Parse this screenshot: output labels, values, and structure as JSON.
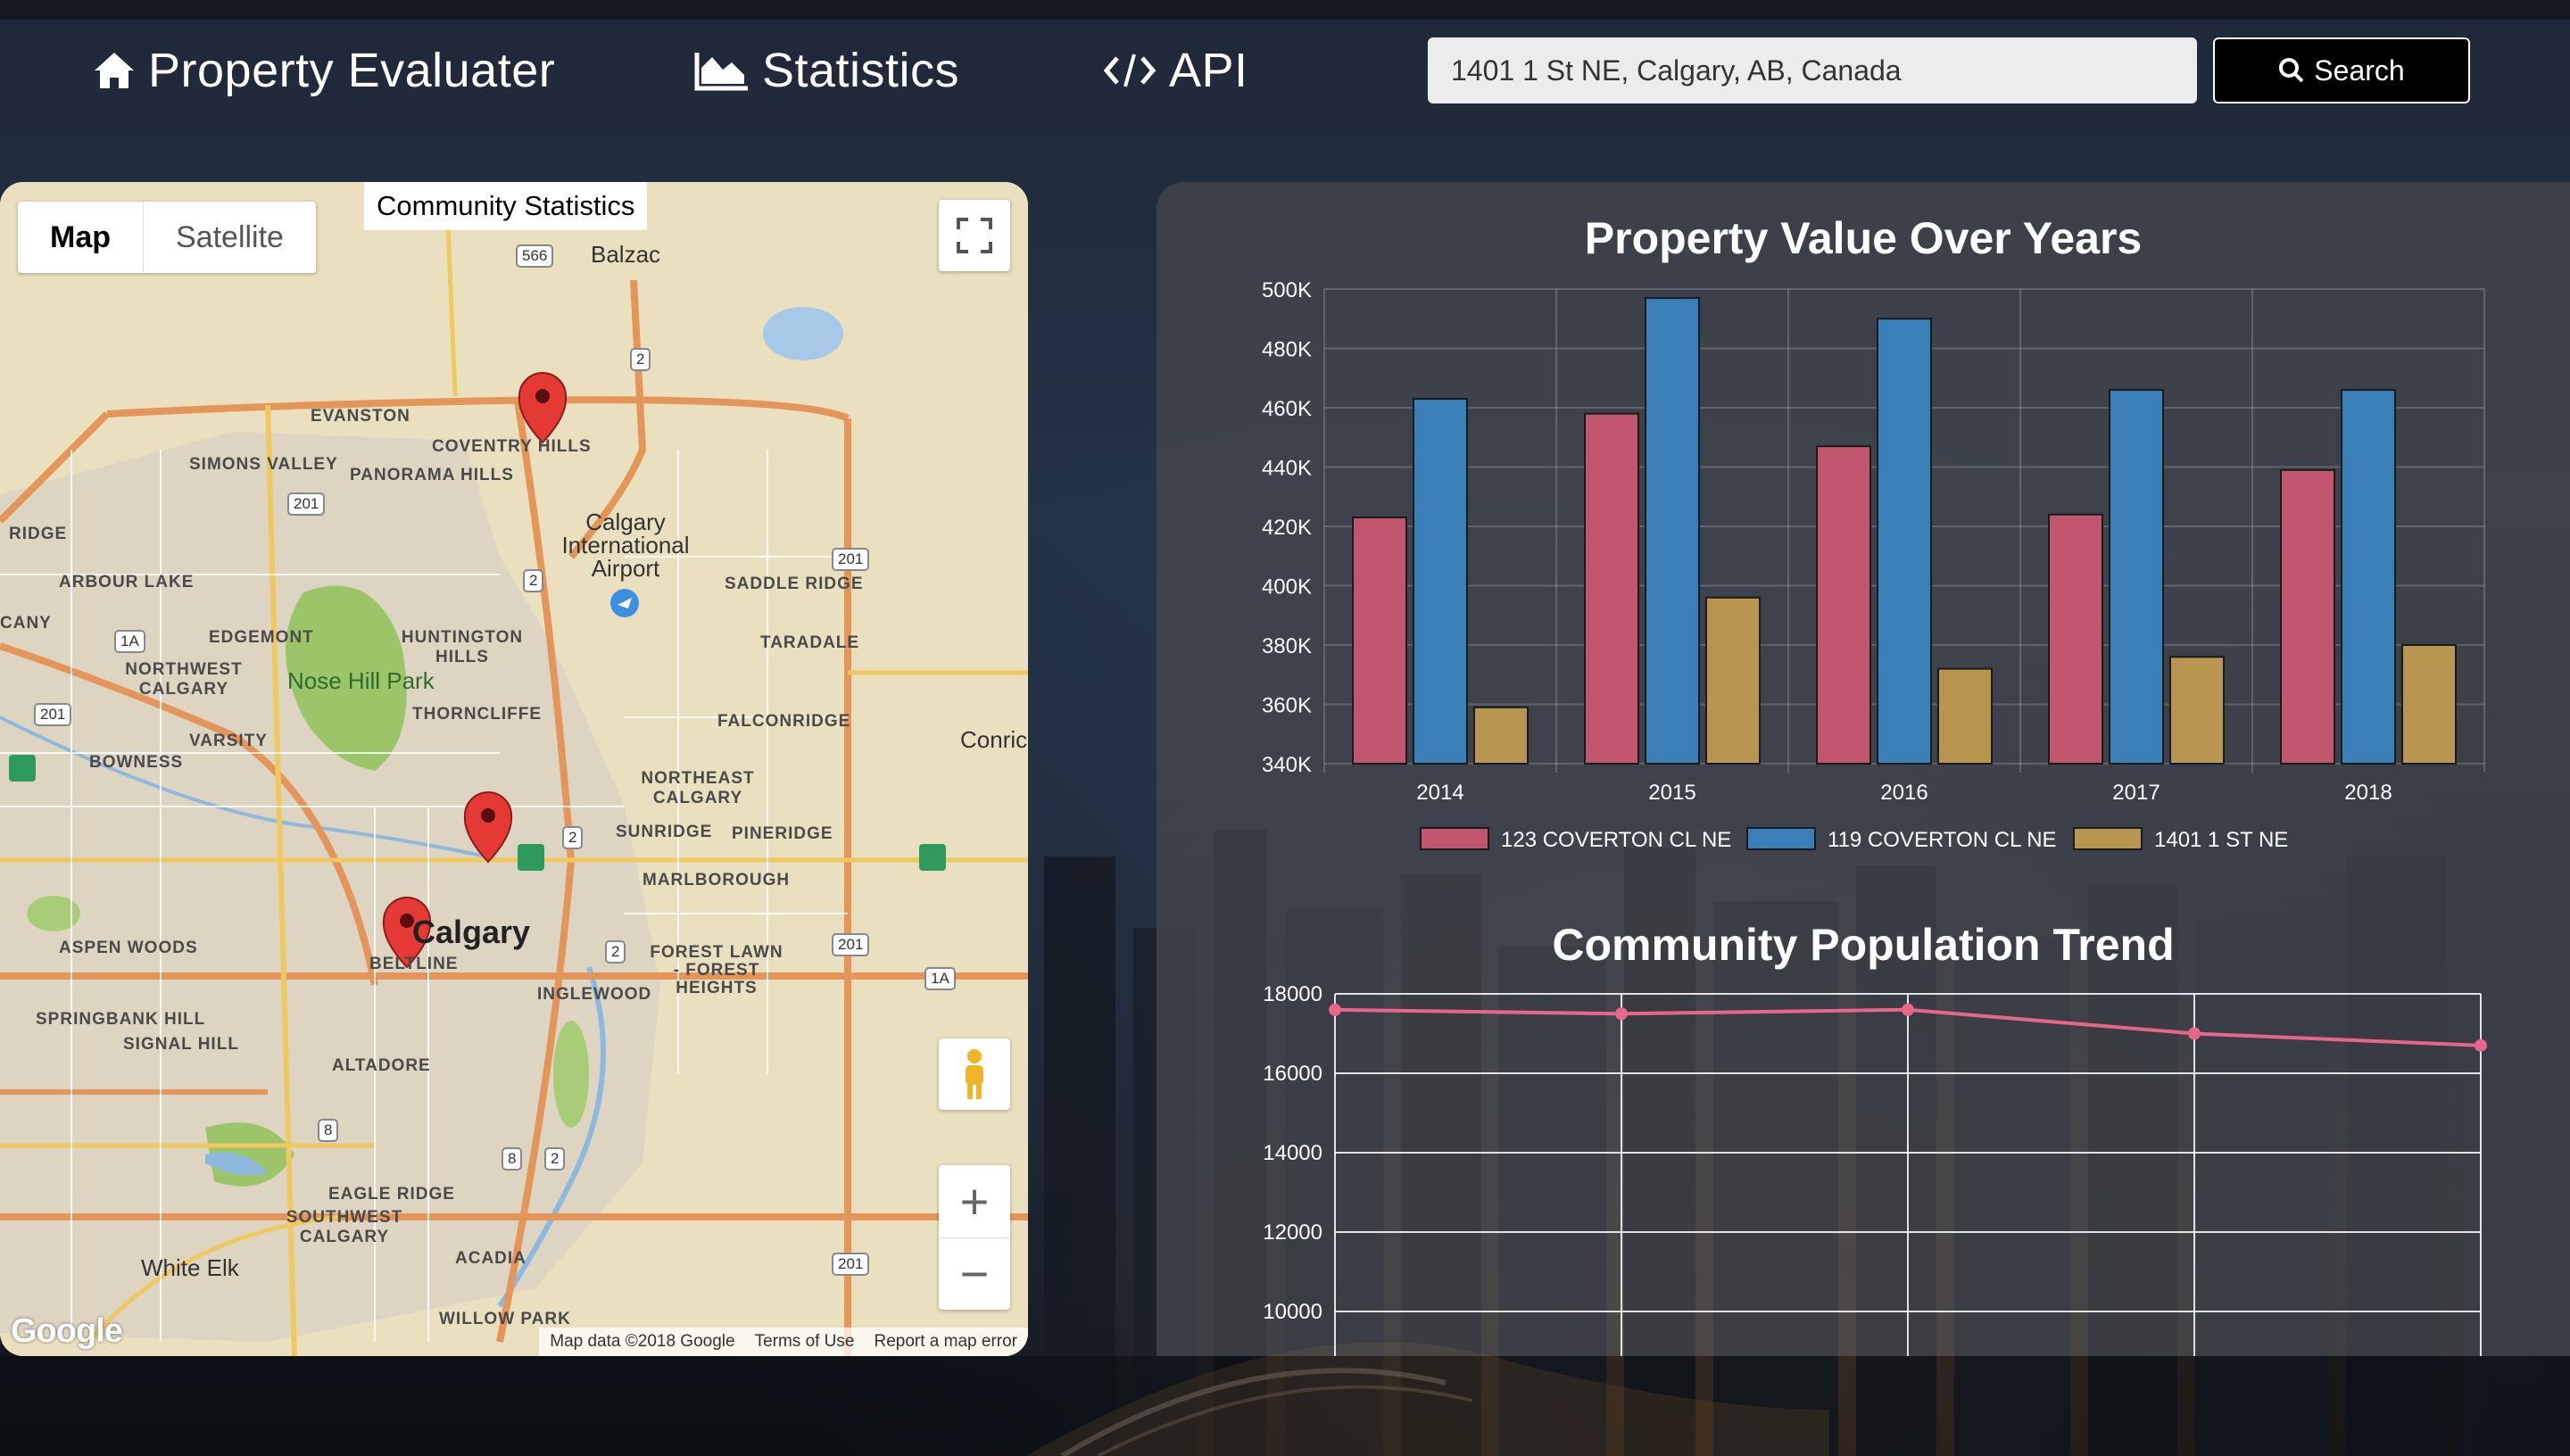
{
  "nav": {
    "brand": "Property Evaluater",
    "statistics": "Statistics",
    "api": "API"
  },
  "search": {
    "value": "1401 1 St NE, Calgary, AB, Canada",
    "button_label": "Search"
  },
  "map": {
    "type_map": "Map",
    "type_satellite": "Satellite",
    "label": "Community Statistics",
    "zoom_in": "+",
    "zoom_out": "−",
    "footer_data": "Map data ©2018 Google",
    "footer_terms": "Terms of Use",
    "footer_report": "Report a map error",
    "google": "Google",
    "places": {
      "balzac": "Balzac",
      "evanston": "EVANSTON",
      "coventry_hills": "COVENTRY HILLS",
      "simons_valley": "SIMONS VALLEY",
      "panorama_hills": "PANORAMA HILLS",
      "ridge": "RIDGE",
      "airport": "Calgary International Airport",
      "arbour_lake": "ARBOUR LAKE",
      "saddle_ridge": "SADDLE RIDGE",
      "cany": "CANY",
      "edgemont": "EDGEMONT",
      "huntington_hills": "HUNTINGTON HILLS",
      "taradale": "TARADALE",
      "northwest_calgary": "NORTHWEST CALGARY",
      "nose_hill_park": "Nose Hill Park",
      "thorncliffe": "THORNCLIFFE",
      "falconridge": "FALCONRIDGE",
      "varsity": "VARSITY",
      "conrich": "Conrich",
      "bowness": "BOWNESS",
      "northeast_calgary": "NORTHEAST CALGARY",
      "sunridge": "SUNRIDGE",
      "pineridge": "PINERIDGE",
      "marlborough": "MARLBOROUGH",
      "calgary": "Calgary",
      "aspen_woods": "ASPEN WOODS",
      "beltline": "BELTLINE",
      "forest_lawn": "FOREST LAWN - FOREST HEIGHTS",
      "inglewood": "INGLEWOOD",
      "springbank_hill": "SPRINGBANK HILL",
      "signal_hill": "SIGNAL HILL",
      "altadore": "ALTADORE",
      "eagle_ridge": "EAGLE RIDGE",
      "southwest_calgary": "SOUTHWEST CALGARY",
      "white_elk": "White Elk",
      "acadia": "ACADIA",
      "willow_park": "WILLOW PARK"
    },
    "shields": [
      "566",
      "2",
      "201",
      "201",
      "2",
      "1A",
      "201",
      "2",
      "201",
      "2",
      "1A",
      "8",
      "8",
      "2",
      "201"
    ]
  },
  "colors": {
    "series1": "#c2566f",
    "series2": "#3a7fb8",
    "series3": "#b8964f",
    "line": "#e8668a"
  },
  "chart_data": [
    {
      "type": "bar",
      "title": "Property Value Over Years",
      "categories": [
        "2014",
        "2015",
        "2016",
        "2017",
        "2018"
      ],
      "series": [
        {
          "name": "123 COVERTON CL NE",
          "values": [
            423000,
            458000,
            447000,
            424000,
            439000
          ]
        },
        {
          "name": "119 COVERTON CL NE",
          "values": [
            463000,
            497000,
            490000,
            466000,
            466000
          ]
        },
        {
          "name": "1401 1 ST NE",
          "values": [
            359000,
            396000,
            372000,
            376000,
            380000
          ]
        }
      ],
      "ylim": [
        340000,
        500000
      ],
      "yticks": [
        "340K",
        "360K",
        "380K",
        "400K",
        "420K",
        "440K",
        "460K",
        "480K",
        "500K"
      ],
      "grid": true,
      "legend": "bottom"
    },
    {
      "type": "line",
      "title": "Community Population Trend",
      "x": [
        "",
        "",
        "",
        "",
        ""
      ],
      "series": [
        {
          "values": [
            17600,
            17500,
            17600,
            17000,
            16700
          ]
        }
      ],
      "ylim": [
        10000,
        18000
      ],
      "yticks": [
        "10000",
        "12000",
        "14000",
        "16000",
        "18000"
      ],
      "grid": true
    }
  ]
}
